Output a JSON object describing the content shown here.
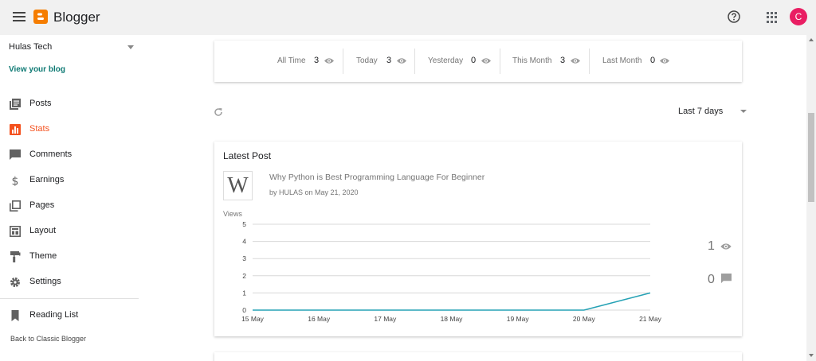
{
  "app": {
    "title": "Blogger",
    "avatar_letter": "C",
    "accent": "#f57d00",
    "avatar_color": "#e91e63"
  },
  "sidebar": {
    "blog_name": "Hulas Tech",
    "view_blog": "View your blog",
    "items": [
      {
        "label": "Posts",
        "icon": "posts-icon",
        "active": false
      },
      {
        "label": "Stats",
        "icon": "stats-icon",
        "active": true
      },
      {
        "label": "Comments",
        "icon": "comments-icon",
        "active": false
      },
      {
        "label": "Earnings",
        "icon": "earnings-icon",
        "active": false
      },
      {
        "label": "Pages",
        "icon": "pages-icon",
        "active": false
      },
      {
        "label": "Layout",
        "icon": "layout-icon",
        "active": false
      },
      {
        "label": "Theme",
        "icon": "theme-icon",
        "active": false
      },
      {
        "label": "Settings",
        "icon": "settings-icon",
        "active": false
      }
    ],
    "reading_list": "Reading List",
    "classic_link": "Back to Classic Blogger",
    "active_color": "#f4511e"
  },
  "overview": [
    {
      "label": "All Time",
      "value": "3"
    },
    {
      "label": "Today",
      "value": "3"
    },
    {
      "label": "Yesterday",
      "value": "0"
    },
    {
      "label": "This Month",
      "value": "3"
    },
    {
      "label": "Last Month",
      "value": "0"
    }
  ],
  "range": {
    "selected": "Last 7 days"
  },
  "latest_post": {
    "heading": "Latest Post",
    "thumb_letter": "W",
    "title": "Why Python is Best Programming Language For Beginner",
    "meta": "by HULAS on May 21, 2020",
    "views": "1",
    "comments": "0"
  },
  "chart_data": {
    "type": "line",
    "ylabel": "Views",
    "categories": [
      "15 May",
      "16 May",
      "17 May",
      "18 May",
      "19 May",
      "20 May",
      "21 May"
    ],
    "series": [
      {
        "values": [
          0,
          0,
          0,
          0,
          0,
          0,
          1
        ]
      }
    ],
    "ylim": [
      0,
      5
    ],
    "yticks": [
      0,
      1,
      2,
      3,
      4,
      5
    ],
    "grid": true,
    "color": "#26a2b5"
  }
}
